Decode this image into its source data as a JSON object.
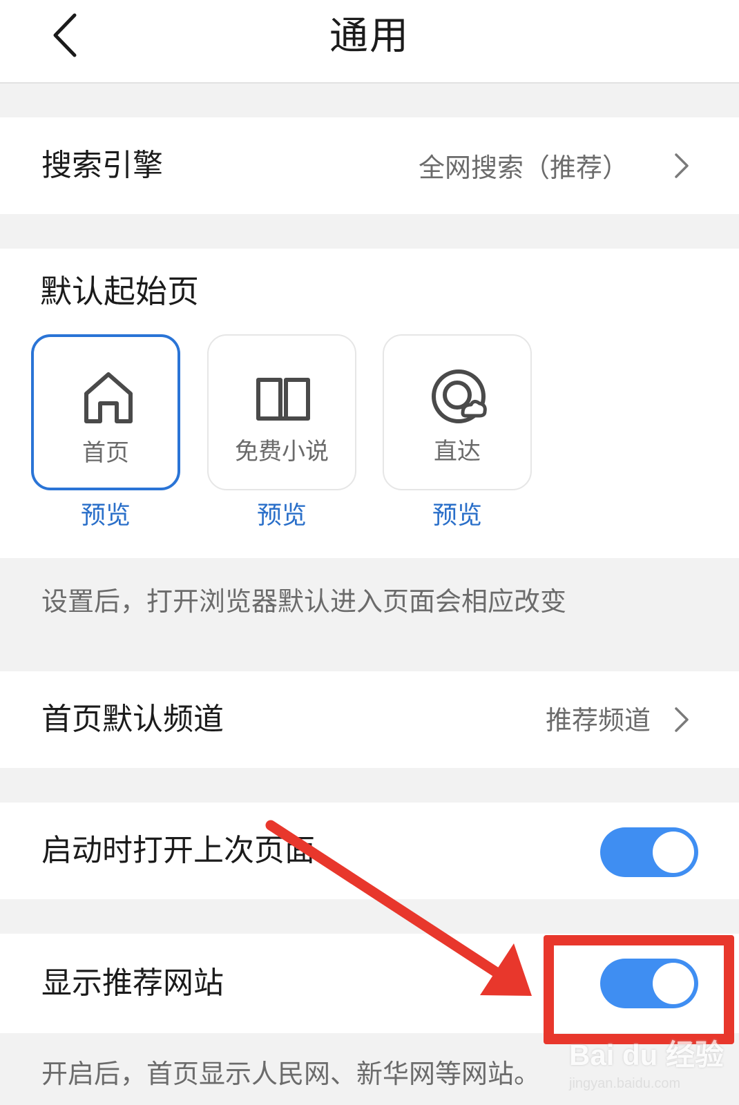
{
  "header": {
    "title": "通用"
  },
  "search_engine": {
    "label": "搜索引擎",
    "value": "全网搜索（推荐）"
  },
  "start_page": {
    "title": "默认起始页",
    "options": [
      {
        "label": "首页",
        "icon": "home-icon",
        "preview": "预览",
        "selected": true
      },
      {
        "label": "免费小说",
        "icon": "book-icon",
        "preview": "预览",
        "selected": false
      },
      {
        "label": "直达",
        "icon": "direct-cloud-icon",
        "preview": "预览",
        "selected": false
      }
    ],
    "note": "设置后，打开浏览器默认进入页面会相应改变"
  },
  "home_channel": {
    "label": "首页默认频道",
    "value": "推荐频道"
  },
  "open_last_page": {
    "label": "启动时打开上次页面",
    "enabled": true
  },
  "show_recommended_sites": {
    "label": "显示推荐网站",
    "enabled": true,
    "note": "开启后，首页显示人民网、新华网等网站。"
  },
  "watermark": {
    "brand": "Bai du 经验",
    "domain": "jingyan.baidu.com"
  },
  "colors": {
    "accent": "#2a74d6",
    "toggle_on": "#3f8ef2",
    "annotation": "#e8372c"
  }
}
